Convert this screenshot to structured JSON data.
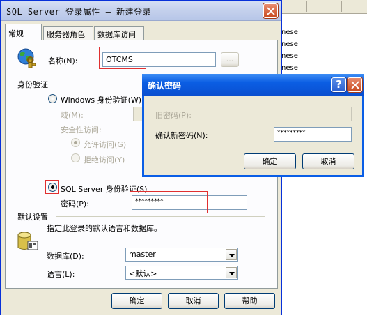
{
  "main_dialog": {
    "title": "SQL Server 登录属性 — 新建登录",
    "tabs": [
      {
        "label": "常规"
      },
      {
        "label": "服务器角色"
      },
      {
        "label": "数据库访问"
      }
    ],
    "name_label": "名称(N):",
    "name_value": "OTCMS",
    "browse_label": "...",
    "auth_group_label": "身份验证",
    "windows_auth_label": "Windows 身份验证(W)",
    "domain_label": "域(M):",
    "security_access_label": "安全性访问:",
    "allow_access_label": "允许访问(G)",
    "deny_access_label": "拒绝访问(Y)",
    "sql_auth_label": "SQL Server 身份验证(S)",
    "password_label": "密码(P):",
    "password_value": "*********",
    "defaults_group_label": "默认设置",
    "defaults_desc": "指定此登录的默认语言和数据库。",
    "database_label": "数据库(D):",
    "database_value": "master",
    "language_label": "语言(L):",
    "language_value": "<默认>",
    "ok_label": "确定",
    "cancel_label": "取消",
    "help_label": "帮助"
  },
  "confirm_dialog": {
    "title": "确认密码",
    "help_glyph": "?",
    "old_password_label": "旧密码(P):",
    "confirm_new_password_label": "确认新密码(N):",
    "confirm_value": "*********",
    "ok_label": "确定",
    "cancel_label": "取消"
  },
  "background_window": {
    "rows": [
      "nese",
      "nese",
      "nese",
      "nese"
    ]
  },
  "colors": {
    "accent_title": "#0a5ee6",
    "highlight_box": "#e03030",
    "face": "#ece9d8"
  }
}
